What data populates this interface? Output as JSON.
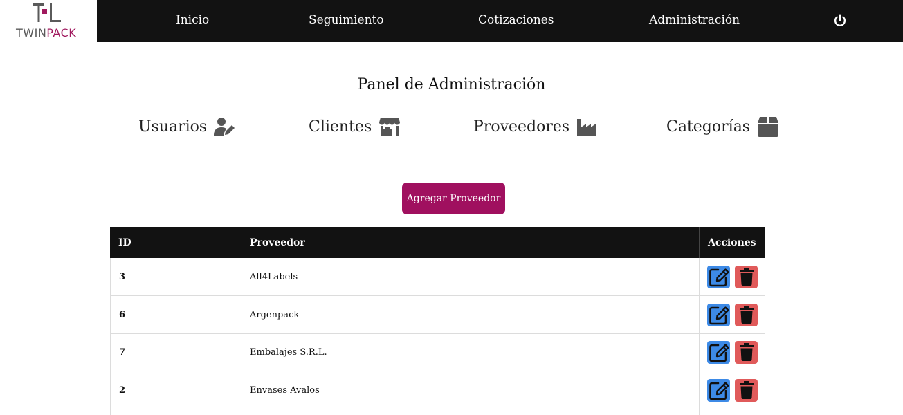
{
  "brand": {
    "name_part1": "TWIN",
    "name_part2": "PACK",
    "mark": "TL"
  },
  "nav": {
    "items": [
      {
        "label": "Inicio"
      },
      {
        "label": "Seguimiento"
      },
      {
        "label": "Cotizaciones"
      },
      {
        "label": "Administración"
      }
    ],
    "power_icon": "power-icon"
  },
  "panel": {
    "title": "Panel de Administración",
    "tabs": [
      {
        "label": "Usuarios",
        "icon": "user-edit-icon"
      },
      {
        "label": "Clientes",
        "icon": "store-icon"
      },
      {
        "label": "Proveedores",
        "icon": "industry-icon"
      },
      {
        "label": "Categorías",
        "icon": "box-icon"
      }
    ]
  },
  "add_button": {
    "label": "Agregar Proveedor"
  },
  "table": {
    "headers": [
      "ID",
      "Proveedor",
      "Acciones"
    ],
    "rows": [
      {
        "id": "3",
        "name": "All4Labels"
      },
      {
        "id": "6",
        "name": "Argenpack"
      },
      {
        "id": "7",
        "name": "Embalajes S.R.L."
      },
      {
        "id": "2",
        "name": "Envases Avalos"
      },
      {
        "id": "",
        "name": ""
      }
    ]
  },
  "colors": {
    "accent": "#a0105f",
    "topbar": "#121212",
    "edit": "#3d8ae6",
    "delete": "#e05a5a"
  }
}
